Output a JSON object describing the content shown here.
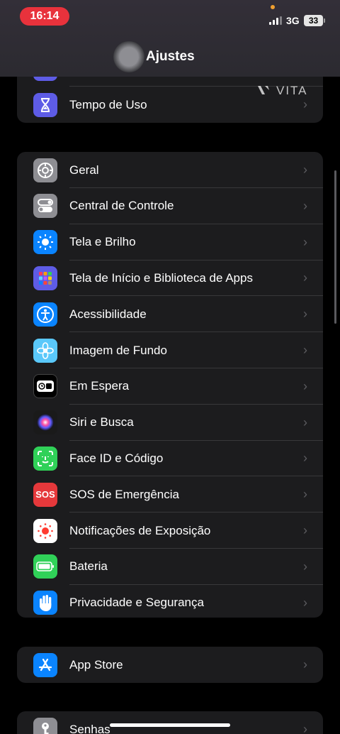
{
  "status": {
    "time": "16:14",
    "network": "3G",
    "battery": "33"
  },
  "header": {
    "title": "Ajustes"
  },
  "watermark": {
    "text": "VITA"
  },
  "group_top": {
    "rows": [
      {
        "label": "Tempo de Uso",
        "icon": "hourglass-icon",
        "color": "#5e5ce6"
      }
    ]
  },
  "group_main": {
    "rows": [
      {
        "label": "Geral",
        "icon": "gear-icon",
        "color": "#8e8e93"
      },
      {
        "label": "Central de Controle",
        "icon": "toggles-icon",
        "color": "#8e8e93"
      },
      {
        "label": "Tela e Brilho",
        "icon": "sun-icon",
        "color": "#0a84ff"
      },
      {
        "label": "Tela de Início e Biblioteca de Apps",
        "icon": "app-grid-icon",
        "color": "#5e5ce6"
      },
      {
        "label": "Acessibilidade",
        "icon": "accessibility-icon",
        "color": "#0a84ff"
      },
      {
        "label": "Imagem de Fundo",
        "icon": "flower-icon",
        "color": "#5ac8fa"
      },
      {
        "label": "Em Espera",
        "icon": "standby-icon",
        "color": "#000000"
      },
      {
        "label": "Siri e Busca",
        "icon": "siri-icon",
        "color": "#222222"
      },
      {
        "label": "Face ID e Código",
        "icon": "face-id-icon",
        "color": "#30d158"
      },
      {
        "label": "SOS de Emergência",
        "icon": "sos-icon",
        "color": "#e5383b",
        "icon_text": "SOS"
      },
      {
        "label": "Notificações de Exposição",
        "icon": "exposure-icon",
        "color": "#ffffff"
      },
      {
        "label": "Bateria",
        "icon": "battery-icon",
        "color": "#30d158"
      },
      {
        "label": "Privacidade e Segurança",
        "icon": "hand-icon",
        "color": "#0a84ff"
      }
    ]
  },
  "group_store": {
    "rows": [
      {
        "label": "App Store",
        "icon": "app-store-icon",
        "color": "#0a84ff"
      }
    ]
  },
  "group_bottom": {
    "rows": [
      {
        "label": "Senhas",
        "icon": "key-icon",
        "color": "#8e8e93"
      }
    ]
  }
}
